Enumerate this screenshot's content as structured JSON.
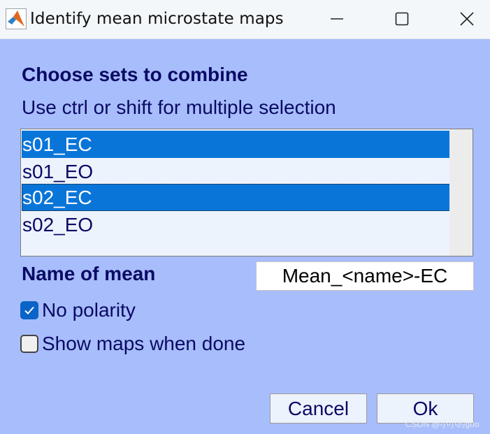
{
  "window": {
    "title": "Identify mean microstate maps",
    "app_icon": "matlab-icon",
    "controls": [
      "minimize-icon",
      "maximize-icon",
      "close-icon"
    ]
  },
  "dialog": {
    "heading": "Choose sets to combine",
    "hint": "Use ctrl or shift for multiple selection",
    "sets": [
      {
        "label": "s01_EC",
        "selected": true
      },
      {
        "label": "s01_EO",
        "selected": false
      },
      {
        "label": "s02_EC",
        "selected": true
      },
      {
        "label": "s02_EO",
        "selected": false
      }
    ],
    "name_label": "Name of mean",
    "name_value": "Mean_<name>-EC",
    "no_polarity": {
      "label": "No polarity",
      "checked": true
    },
    "show_maps": {
      "label": "Show maps when done",
      "checked": false
    },
    "cancel_label": "Cancel",
    "ok_label": "Ok"
  },
  "watermark": "CSDN @小小的guo",
  "colors": {
    "background": "#a8bdfb",
    "selection": "#0a75d8",
    "text": "#0a0a64",
    "checkbox_checked": "#0a63c6"
  }
}
